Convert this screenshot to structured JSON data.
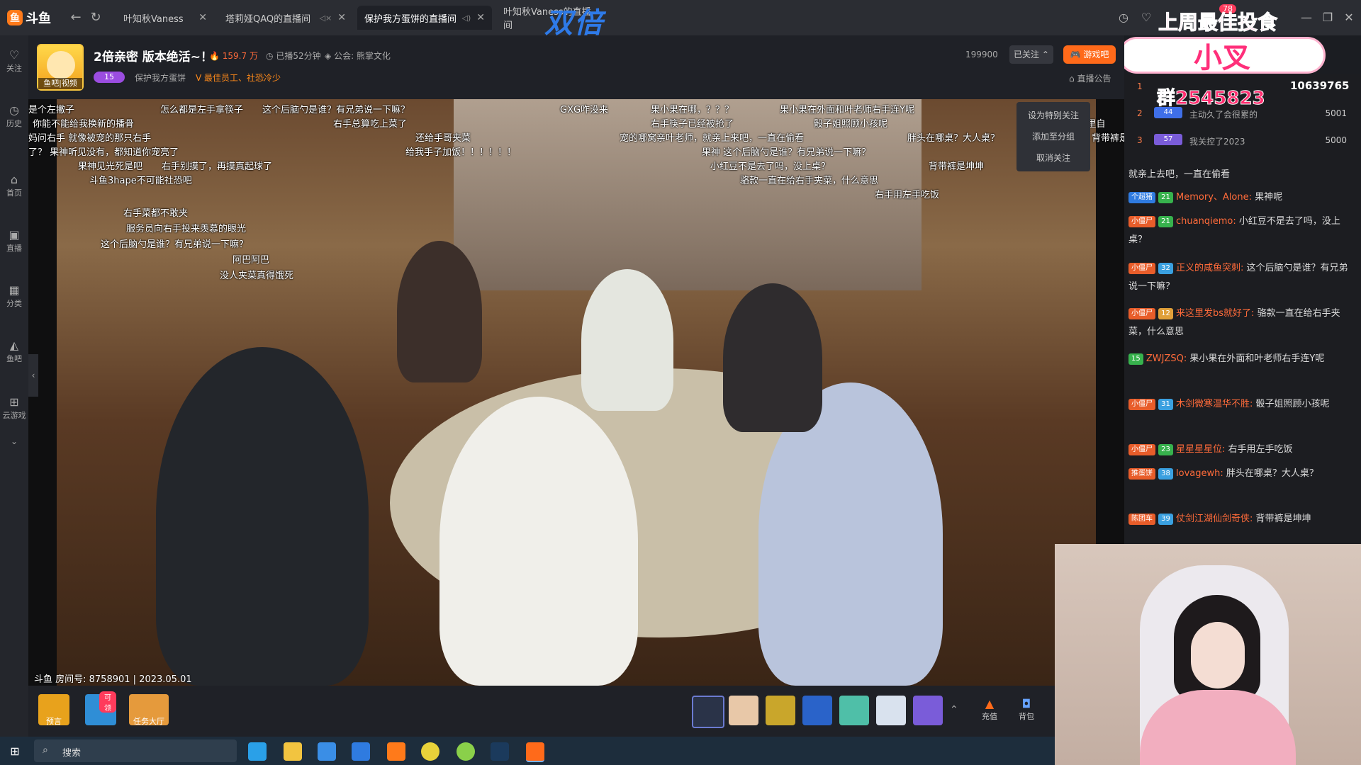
{
  "topbar": {
    "logo_text": "斗鱼",
    "tabs": [
      {
        "label": "叶知秋Vaness",
        "active": false
      },
      {
        "label": "塔莉娅QAQ的直播间",
        "active": false
      },
      {
        "label": "保护我方蛋饼的直播间",
        "active": true
      },
      {
        "label": "叶知秋Vaness的直播间",
        "active": false
      }
    ],
    "overlay_text": "双倍",
    "promo_title": "上周最佳投食",
    "promo_name": "小叉",
    "promo_badge": "78"
  },
  "sidebar": {
    "items": [
      {
        "label": "关注",
        "icon": "heart-icon"
      },
      {
        "label": "历史",
        "icon": "clock-icon"
      },
      {
        "label": "首页",
        "icon": "home-icon"
      },
      {
        "label": "直播",
        "icon": "tv-icon"
      },
      {
        "label": "分类",
        "icon": "grid-icon"
      },
      {
        "label": "鱼吧",
        "icon": "fish-icon"
      },
      {
        "label": "云游戏",
        "icon": "gamepad-icon"
      }
    ]
  },
  "room": {
    "avatar_label": "鱼吧|视频",
    "title": "2倍亲密 版本绝活~！",
    "hot": "159.7 万",
    "played": "已播52分钟",
    "guild": "公会: 熊掌文化",
    "level": "15",
    "fans_name": "保护我方蛋饼",
    "tagline": "最佳员工、社恐冷少",
    "follow_count": "199900",
    "followed_label": "已关注",
    "game_label": "游戏吧",
    "announce_label": "直播公告",
    "follow_menu": [
      "设为特别关注",
      "添加至分组",
      "取消关注"
    ],
    "room_no": "斗鱼 房间号: 8758901 | 2023.05.01"
  },
  "danmaku": [
    "是个左撇子",
    "怎么都是左手拿筷子",
    "这个后脑勺是谁？有兄弟说一下嘛？",
    "GXG咋没来",
    "果小果在哪，？？？",
    "果小果在外面和叶老师右手连Y呢",
    "饭",
    "你能不能给我换新的播骨",
    "右手总算吃上菜了",
    "右手筷子已经被抢了",
    "骰子姐照顾小孩呢",
    ": 手子嘴里自",
    "妈问右手  就像被宠的那只右手",
    "还给手哥夹菜",
    "宠的哪窝亲叶老师，就亲上来吧，一直在偷看",
    "胖头在哪桌？大人桌？",
    "背带裤是坤",
    "了？ 果神听见没有，都知道你宠亮了",
    "给我手子加饭！！！！！！",
    "果神 这个后脑勺是谁？有兄弟说一下嘛？",
    "果神见光死是吧",
    "右手别摸了，再摸真起球了",
    "小红豆不是去了吗，没上桌？",
    "背带裤是坤坤",
    "斗鱼3hape不可能社恐吧",
    "骆款一直在给右手夹菜，什么意思",
    "右手用左手吃饭",
    "右手菜都不敢夹",
    "服务员向右手投来羡慕的眼光",
    "这个后脑勺是谁？有兄弟说一下嘛？",
    "阿巴阿巴",
    "没人夹菜真得饿死"
  ],
  "gifts": {
    "left": [
      {
        "label": "预言"
      },
      {
        "label": "可领"
      },
      {
        "label": "任务大厅"
      }
    ],
    "recharge_label": "充值",
    "backpack_label": "背包"
  },
  "chat": {
    "ranks": [
      {
        "no": "1",
        "name": "群2545823",
        "value": "10639765",
        "flag": ""
      },
      {
        "no": "2",
        "name": "主动久了会很累的",
        "value": "5001",
        "flag": "44"
      },
      {
        "no": "3",
        "name": "我关控了2023",
        "value": "5000",
        "flag": "57"
      }
    ],
    "messages": [
      {
        "badge": "",
        "level": "",
        "user": "",
        "text": "就亲上去吧，一直在偷看"
      },
      {
        "badge": "个超猪",
        "level": "21",
        "user": "Memory、Alone:",
        "text": "果神呢"
      },
      {
        "badge": "小僵尸",
        "level": "21",
        "user": "chuanqiemo:",
        "text": "小红豆不是去了吗，没上桌？"
      },
      {
        "badge": "小僵尸",
        "level": "32",
        "user": "正义的咸鱼突刺:",
        "text": "这个后脑勺是谁？有兄弟说一下嘛？"
      },
      {
        "badge": "小僵尸",
        "level": "12",
        "user": "来这里发bs就好了:",
        "text": "骆款一直在给右手夹菜，什么意思"
      },
      {
        "badge": "",
        "level": "15",
        "user": "ZWJZSQ:",
        "text": "果小果在外面和叶老师右手连Y呢"
      },
      {
        "badge": "小僵尸",
        "level": "31",
        "user": "木剑微寒温华不胜:",
        "text": "骰子姐照顾小孩呢"
      },
      {
        "badge": "小僵尸",
        "level": "23",
        "user": "星星星星位:",
        "text": "右手用左手吃饭"
      },
      {
        "badge": "推蛋饼",
        "level": "38",
        "user": "lovagewh:",
        "text": "胖头在哪桌？大人桌？"
      },
      {
        "badge": "陈团车",
        "level": "39",
        "user": "仗剑江湖仙剑奇侠:",
        "text": "背带裤是坤坤"
      }
    ]
  },
  "taskbar": {
    "search_placeholder": "搜索"
  }
}
